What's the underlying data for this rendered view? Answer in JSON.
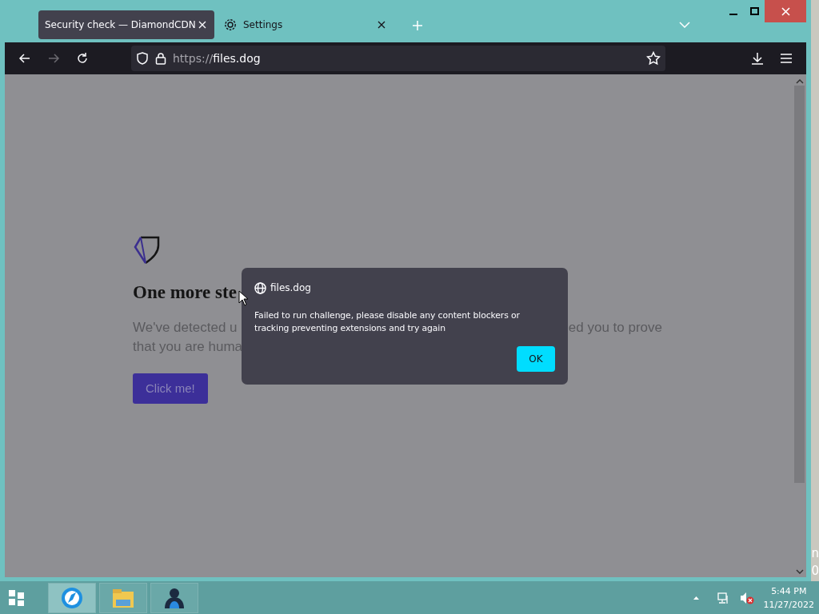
{
  "browser": {
    "tabs": [
      {
        "label": "Security check — DiamondCDN",
        "selected": true,
        "kind": "page"
      },
      {
        "label": "Settings",
        "selected": false,
        "kind": "settings"
      }
    ],
    "nav": [
      {
        "kind": "back",
        "disabled": false
      },
      {
        "kind": "forward",
        "disabled": true
      },
      {
        "kind": "reload",
        "disabled": false
      }
    ],
    "address": {
      "scheme": "https://",
      "host": "files.dog"
    }
  },
  "page": {
    "heading": "One more ste",
    "paragraph_lines": [
      [
        "We've detected u",
        "ed you to prove"
      ],
      [
        "that you are huma"
      ]
    ],
    "button": "Click me!"
  },
  "dialog": {
    "origin": "files.dog",
    "message": "Failed to run challenge, please disable any content blockers or tracking preventing extensions and try again",
    "button": "OK"
  },
  "desktop_fragments": [
    "n",
    "0"
  ],
  "taskbar": {
    "apps": [
      {
        "kind": "browser",
        "selected": true
      },
      {
        "kind": "files",
        "selected": false
      },
      {
        "kind": "people",
        "selected": false
      }
    ],
    "time": "5:44 PM",
    "date": "11/27/2022",
    "sound_muted": true
  }
}
